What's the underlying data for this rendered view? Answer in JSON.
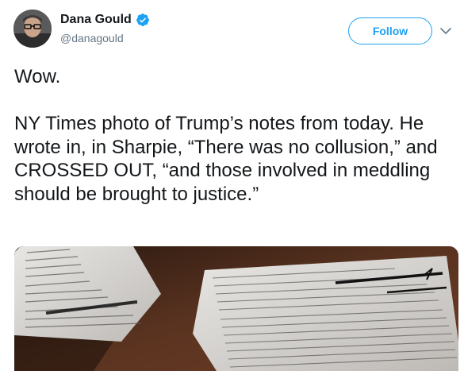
{
  "author": {
    "display_name": "Dana Gould",
    "handle": "@danagould",
    "verified": true
  },
  "actions": {
    "follow_label": "Follow"
  },
  "tweet": {
    "paragraphs": [
      "Wow.",
      "NY Times photo of Trump’s notes from today. He wrote in, in Sharpie, “There was no collusion,” and CROSSED OUT, “and those involved in meddling should be brought to justice.”"
    ]
  },
  "media": {
    "kind": "photo",
    "subject": "handwritten-notes-on-paper"
  },
  "colors": {
    "accent": "#1da1f2",
    "text": "#14171a",
    "secondary_text": "#657786",
    "table_wood": "#3a2418"
  },
  "icons": [
    "verified-badge-icon",
    "chevron-down-icon"
  ]
}
